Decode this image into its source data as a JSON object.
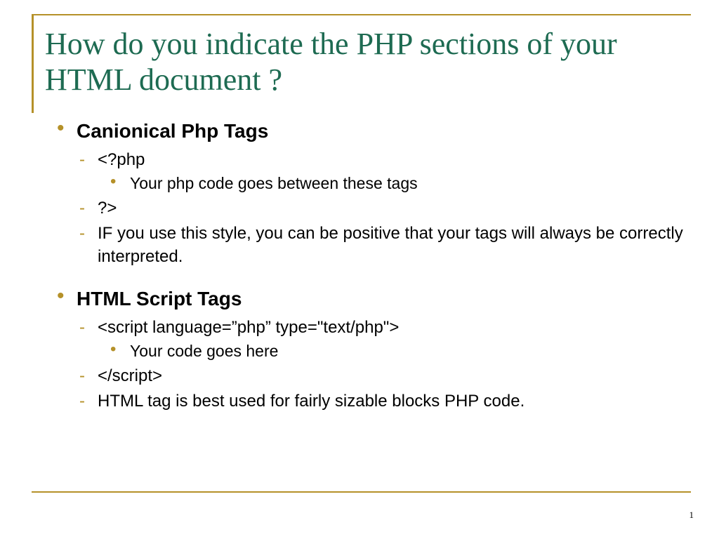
{
  "title": "How do you indicate the PHP sections of your HTML document ?",
  "sections": [
    {
      "heading": "Canionical Php Tags",
      "items": [
        {
          "text": "<?php",
          "sub": [
            "Your php code goes between these tags"
          ]
        },
        {
          "text": " ?>"
        },
        {
          "text": "IF you use this style, you can be positive that your tags will always be correctly interpreted."
        }
      ]
    },
    {
      "heading": "HTML Script Tags",
      "items": [
        {
          "text": "<script language=”php” type=\"text/php\">",
          "sub": [
            "Your code goes here"
          ]
        },
        {
          "text": "</script>"
        },
        {
          "text": "HTML tag is best used for fairly sizable blocks PHP code."
        }
      ]
    }
  ],
  "pageNumber": "1"
}
